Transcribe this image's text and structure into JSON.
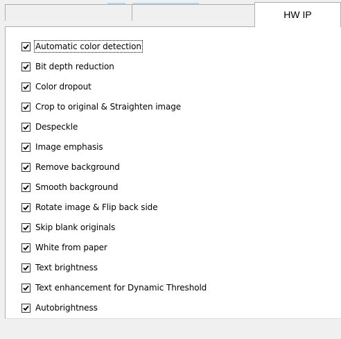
{
  "tabs": [
    {
      "label": ""
    },
    {
      "label": ""
    },
    {
      "label": "HW IP",
      "active": true
    }
  ],
  "options": [
    {
      "label": "Automatic color detection",
      "checked": true,
      "focused": true
    },
    {
      "label": "Bit depth reduction",
      "checked": true
    },
    {
      "label": "Color dropout",
      "checked": true
    },
    {
      "label": "Crop to original & Straighten image",
      "checked": true
    },
    {
      "label": "Despeckle",
      "checked": true
    },
    {
      "label": "Image emphasis",
      "checked": true
    },
    {
      "label": "Remove background",
      "checked": true
    },
    {
      "label": "Smooth background",
      "checked": true
    },
    {
      "label": "Rotate image & Flip back side",
      "checked": true
    },
    {
      "label": "Skip blank originals",
      "checked": true
    },
    {
      "label": "White from paper",
      "checked": true
    },
    {
      "label": "Text brightness",
      "checked": true
    },
    {
      "label": "Text enhancement for Dynamic Threshold",
      "checked": true
    },
    {
      "label": "Autobrightness",
      "checked": true
    }
  ]
}
